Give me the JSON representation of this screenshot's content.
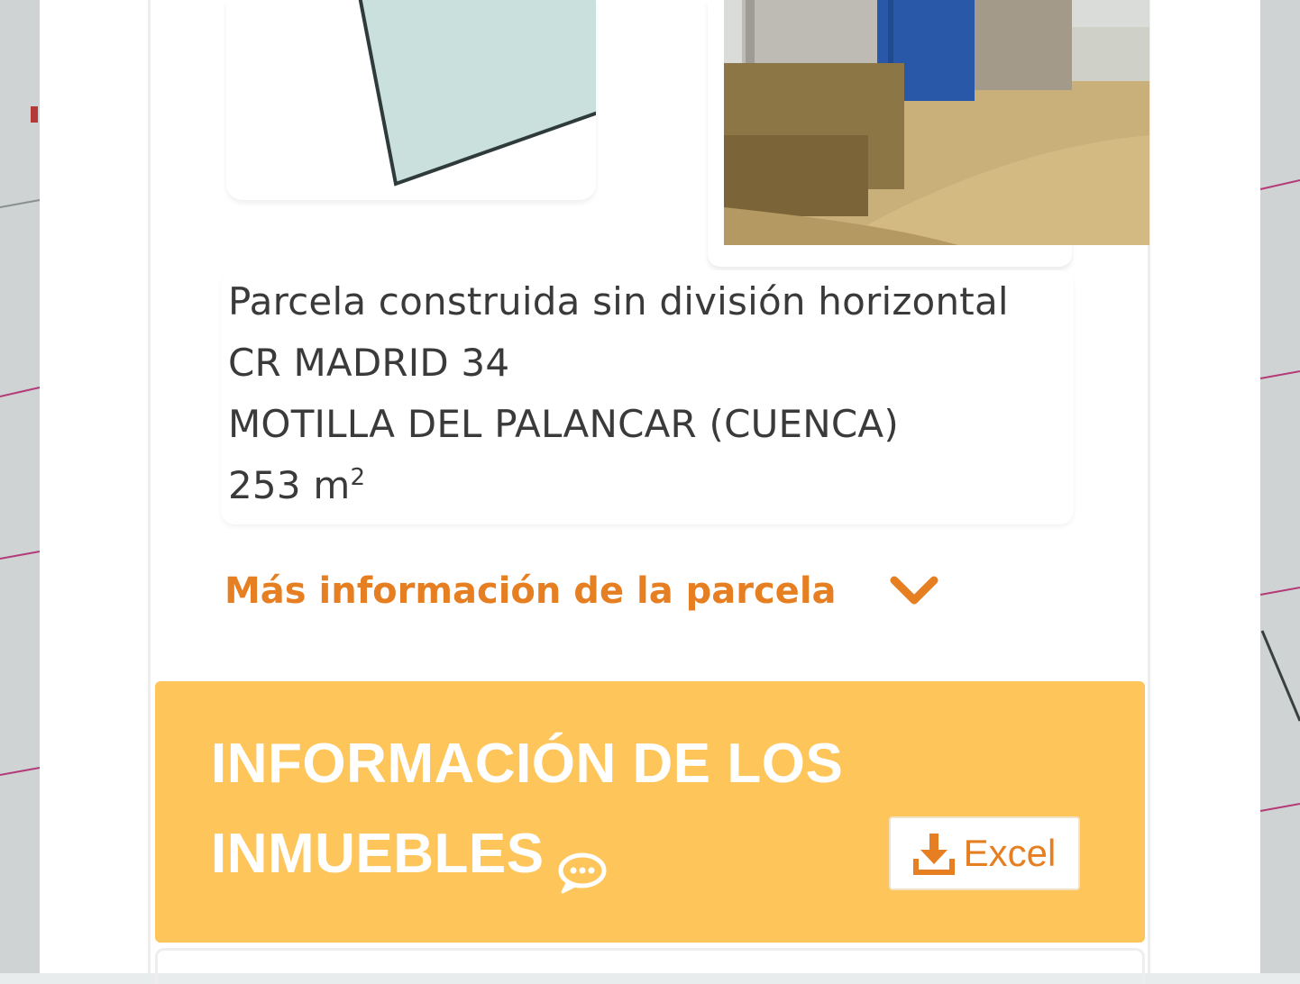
{
  "parcel": {
    "type": "Parcela construida sin división horizontal",
    "address": "CR MADRID 34",
    "municipality": "MOTILLA DEL PALANCAR (CUENCA)",
    "surface_value": "253 m",
    "surface_unit_exp": "2"
  },
  "more_info": {
    "label": "Más información de la parcela",
    "icon": "chevron-down-icon"
  },
  "inmuebles": {
    "title_line1": "INFORMACIÓN DE LOS",
    "title_line2": "INMUEBLES",
    "chat_icon": "chat-bubble-icon",
    "excel_label": "Excel",
    "excel_icon": "download-icon"
  },
  "colors": {
    "accent": "#e67e22",
    "header_bg": "#fec55a",
    "sketch_fill": "#c9e0dc"
  }
}
